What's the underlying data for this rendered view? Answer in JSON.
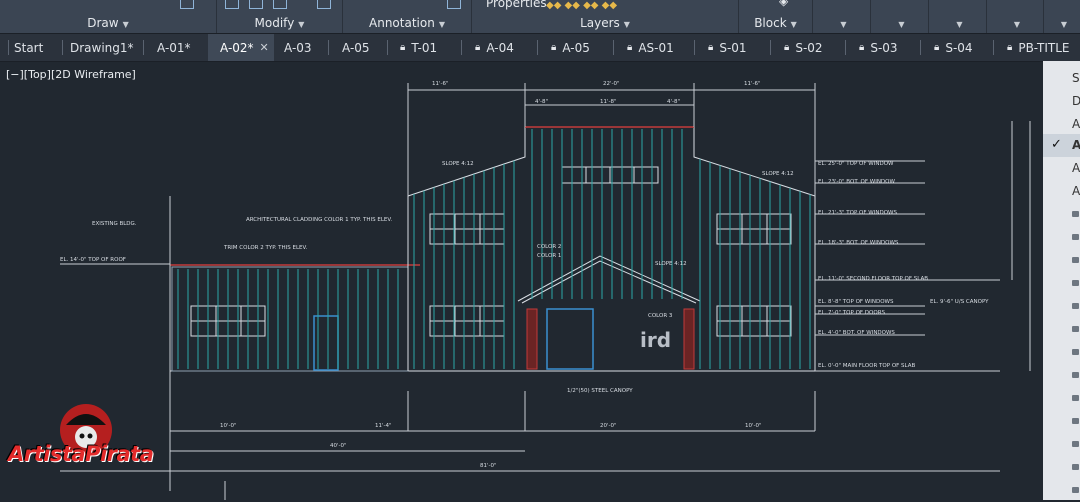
{
  "ribbon": {
    "groups": [
      {
        "label": "Draw"
      },
      {
        "label": "Modify"
      },
      {
        "label": "Annotation"
      },
      {
        "label": "Layers"
      },
      {
        "label": "Block"
      }
    ],
    "properties_label": "Properties"
  },
  "tabs": [
    {
      "label": "Start",
      "locked": false
    },
    {
      "label": "Drawing1*",
      "locked": false
    },
    {
      "label": "A-01*",
      "locked": false
    },
    {
      "label": "A-02*",
      "locked": false,
      "active": true
    },
    {
      "label": "A-03",
      "locked": false
    },
    {
      "label": "A-05",
      "locked": false
    },
    {
      "label": "T-01",
      "locked": true
    },
    {
      "label": "A-04",
      "locked": true
    },
    {
      "label": "A-05",
      "locked": true
    },
    {
      "label": "AS-01",
      "locked": true
    },
    {
      "label": "S-01",
      "locked": true
    },
    {
      "label": "S-02",
      "locked": true
    },
    {
      "label": "S-03",
      "locked": true
    },
    {
      "label": "S-04",
      "locked": true
    },
    {
      "label": "PB-TITLE",
      "locked": true
    }
  ],
  "viewport_label": "[−][Top][2D Wireframe]",
  "right_panel": {
    "items": [
      "St",
      "Dr",
      "A",
      "A",
      "A",
      "A"
    ],
    "checked_index": 3
  },
  "watermark": {
    "text": "ArtistaPirata"
  },
  "drawing": {
    "dimensions_top": [
      "11'-6\"",
      "22'-0\"",
      "11'-6\"",
      "4'-8\"",
      "11'-8\"",
      "4'-8\""
    ],
    "slopes": [
      "SLOPE 4:12",
      "SLOPE 4:12",
      "SLOPE 4:12"
    ],
    "center_mark": "ird",
    "elevation_labels": [
      "EL. 25'-0\" TOP OF WINDOW",
      "EL. 23'-0\" BOT. OF WINDOW",
      "EL. 21'-3\" TOP OF WINDOWS",
      "EL. 18'-3\" BOT. OF WINDOWS",
      "EL. 11'-0\" SECOND FLOOR TOP OF SLAB",
      "EL. 8'-8\" TOP OF WINDOWS",
      "EL. 7'-0\" TOP OF DOORS",
      "EL. 4'-0\" BOT. OF WINDOWS",
      "EL. 0'-0\" MAIN FLOOR TOP OF SLAB"
    ],
    "left_labels": [
      "EXISTING BLDG.",
      "EL. 14'-0\" TOP OF ROOF"
    ],
    "notes": [
      "ARCHITECTURAL CLADDING COLOR 1 TYP. THIS ELEV.",
      "TRIM COLOR 2 TYP. THIS ELEV.",
      "COLOR 2",
      "COLOR 1",
      "COLOR 3",
      "SLOPE 4:12",
      "1/2\"(50) STEEL CANOPY",
      "EL. 9'-6\" U/S CANOPY"
    ],
    "bottom_dims": [
      "40'-0\"",
      "81'-0\"",
      "20'-0\"",
      "10'-0\"",
      "11'-4\"",
      "10'-0\""
    ],
    "accent": "#2aa7a8",
    "line": "#d9dee4",
    "red": "#c23a3a"
  }
}
